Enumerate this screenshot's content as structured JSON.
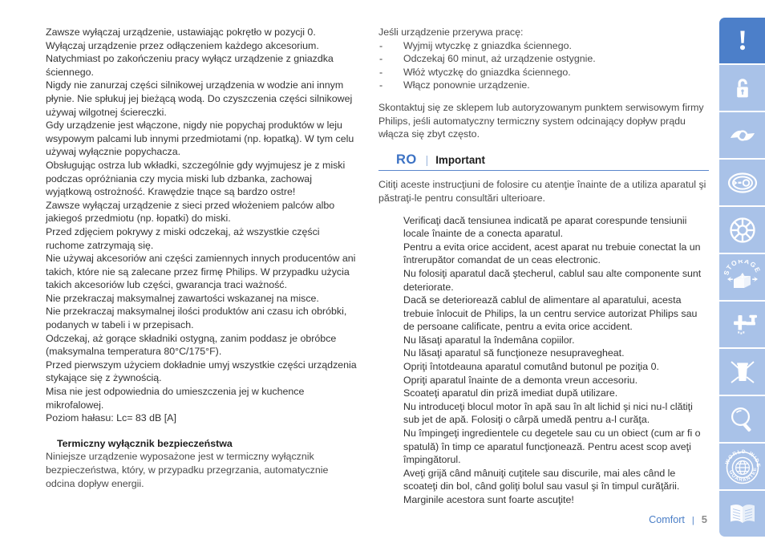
{
  "footer": {
    "brand": "Comfort",
    "separator": "|",
    "page_number": "5"
  },
  "left_column": {
    "safety_lines": [
      "Zawsze wyłączaj urządzenie, ustawiając pokrętło w pozycji 0.",
      "Wyłączaj urządzenie przez odłączeniem każdego akcesorium.",
      "Natychmiast po zakończeniu pracy wyłącz urządzenie z gniazdka ściennego.",
      "Nigdy nie zanurzaj części silnikowej urządzenia w wodzie ani innym płynie. Nie spłukuj jej bieżącą wodą. Do czyszczenia części silnikowej używaj wilgotnej ściereczki.",
      "Gdy urządzenie jest włączone, nigdy nie popychaj produktów w leju wsypowym palcami lub innymi przedmiotami (np. łopatką). W tym celu używaj wyłącznie popychacza.",
      "Obsługując ostrza lub wkładki, szczególnie gdy wyjmujesz je z miski podczas opróżniania czy mycia miski lub dzbanka, zachowaj wyjątkową ostrożność. Krawędzie tnące są bardzo ostre!",
      "Zawsze wyłączaj urządzenie z sieci przed włożeniem palców albo jakiegoś przedmiotu (np. łopatki) do miski.",
      "Przed zdjęciem pokrywy z miski odczekaj, aż wszystkie części ruchome zatrzymają się.",
      "Nie używaj akcesoriów ani części zamiennych innych producentów ani takich, które nie są zalecane przez firmę Philips. W przypadku użycia takich akcesoriów lub części, gwarancja traci ważność.",
      "Nie przekraczaj maksymalnej zawartości wskazanej na misce.",
      "Nie przekraczaj maksymalnej ilości produktów ani czasu ich obróbki, podanych w tabeli i w przepisach.",
      "Odczekaj, aż gorące składniki ostygną, zanim poddasz je obróbce (maksymalna temperatura 80°C/175°F).",
      "Przed pierwszym użyciem dokładnie umyj wszystkie części urządzenia stykające się z żywnością.",
      "Misa nie jest odpowiednia do umieszczenia jej w kuchence mikrofalowej.",
      "Poziom hałasu: Lc= 83 dB [A]"
    ],
    "thermal_heading": "Termiczny wyłącznik bezpieczeństwa",
    "thermal_body": "Niniejsze urządzenie wyposażone jest w termiczny wyłącznik bezpieczeństwa, który, w przypadku przegrzania, automatycznie odcina dopływ energii."
  },
  "right_column": {
    "interrupt_intro": "Jeśli urządzenie przerywa pracę:",
    "dash": "-",
    "interrupt_steps": [
      "Wyjmij wtyczkę z gniazdka ściennego.",
      "Odczekaj 60 minut, aż urządzenie ostygnie.",
      "Włóż wtyczkę do gniazdka ściennego.",
      "Włącz ponownie urządzenie."
    ],
    "contact_note": "Skontaktuj się ze sklepem lub autoryzowanym punktem serwisowym firmy Philips, jeśli automatyczny termiczny system odcinający dopływ prądu włącza się zbyt często.",
    "section": {
      "code": "RO",
      "pipe": "|",
      "title": "Important"
    },
    "ro_intro": "Citiţi aceste instrucţiuni de folosire cu atenţie înainte de a utiliza aparatul şi păstraţi-le pentru consultări ulterioare.",
    "ro_items": [
      "Verificaţi dacă tensiunea indicată pe aparat corespunde tensiunii locale înainte de a conecta aparatul.",
      "Pentru a evita orice accident, acest aparat nu trebuie conectat la un întrerupător comandat de un ceas electronic.",
      "Nu folosiţi aparatul dacă ştecherul, cablul sau alte componente sunt deteriorate.",
      "Dacă se deteriorează cablul de alimentare al aparatului, acesta trebuie înlocuit de Philips, la un centru service autorizat Philips sau de persoane calificate, pentru a evita orice accident.",
      "Nu lăsaţi aparatul la îndemâna copiilor.",
      "Nu lăsaţi aparatul să funcţioneze nesupravegheat.",
      "Opriţi întotdeauna aparatul comutând butonul pe poziţia 0.",
      "Opriţi aparatul înainte de a demonta vreun accesoriu.",
      "Scoateţi aparatul din priză imediat după utilizare.",
      "Nu introduceţi blocul motor în apă sau în alt lichid şi nici nu-l clătiţi sub jet de apă. Folosiţi o cârpă umedă pentru a-l curăţa.",
      "Nu împingeţi ingredientele cu degetele sau cu un obiect (cum ar fi o spatulă) în timp ce aparatul funcţionează. Pentru acest scop aveţi împingătorul.",
      "Aveţi grijă când mânuiţi cuţitele sau discurile, mai ales când le scoateţi din bol, când goliţi bolul sau vasul şi în timpul curăţării. Marginile acestora sunt foarte ascuţite!"
    ]
  },
  "sidebar": {
    "icons": [
      {
        "name": "exclamation-icon",
        "label": "Important"
      },
      {
        "name": "unlock-icon",
        "label": "Unlock"
      },
      {
        "name": "blade-icon",
        "label": "Blade"
      },
      {
        "name": "disc-icon",
        "label": "Disc"
      },
      {
        "name": "fan-blade-icon",
        "label": "Fan blade"
      },
      {
        "name": "storage-box-icon",
        "label": "STORAGE"
      },
      {
        "name": "faucet-icon",
        "label": "Cleaning"
      },
      {
        "name": "no-waste-bin-icon",
        "label": "Do not dispose"
      },
      {
        "name": "magnifier-icon",
        "label": "Troubleshooting"
      },
      {
        "name": "worldwide-guarantee-icon",
        "label": "WORLD-WIDE GUARANTEE"
      },
      {
        "name": "open-book-icon",
        "label": "Manual"
      }
    ],
    "storage_label": "STORAGE",
    "guarantee_top_label": "WORLD-WIDE",
    "guarantee_bottom_label": "GUARANTEE"
  },
  "colors": {
    "accent_blue": "#3c72c4",
    "sidebar_light": "#a9c2e8",
    "sidebar_primary": "#4c7fc9",
    "rule_blue": "#5a86cc",
    "body_text": "#333333"
  }
}
